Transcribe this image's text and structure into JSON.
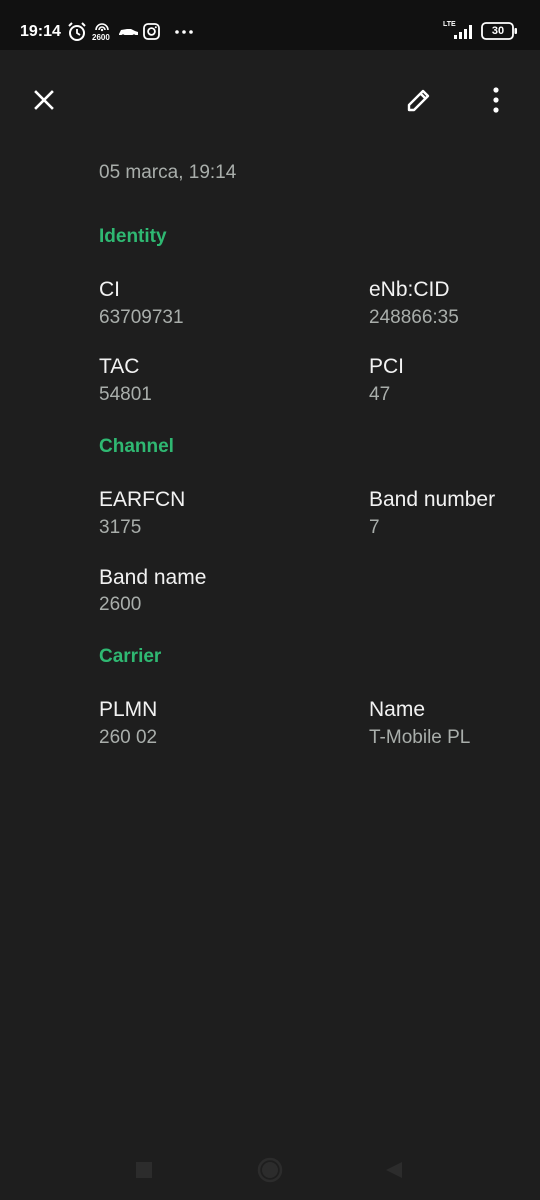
{
  "status_bar": {
    "time": "19:14",
    "hotspot_label": "2600",
    "network_type": "LTE",
    "battery_level": "30",
    "icons": [
      "alarm-icon",
      "hotspot-icon",
      "car-icon",
      "instagram-icon",
      "more-dots-icon",
      "signal-icon",
      "battery-icon"
    ]
  },
  "toolbar": {
    "icons": [
      "close-icon",
      "edit-icon",
      "more-vert-icon"
    ]
  },
  "record": {
    "timestamp": "05 marca, 19:14"
  },
  "sections": {
    "identity": {
      "title": "Identity",
      "ci_label": "CI",
      "ci_value": "63709731",
      "enb_label": "eNb:CID",
      "enb_value": "248866:35",
      "tac_label": "TAC",
      "tac_value": "54801",
      "pci_label": "PCI",
      "pci_value": "47"
    },
    "channel": {
      "title": "Channel",
      "earfcn_label": "EARFCN",
      "earfcn_value": "3175",
      "band_number_label": "Band number",
      "band_number_value": "7",
      "band_name_label": "Band name",
      "band_name_value": "2600"
    },
    "carrier": {
      "title": "Carrier",
      "plmn_label": "PLMN",
      "plmn_value": "260 02",
      "name_label": "Name",
      "name_value": "T-Mobile PL"
    }
  },
  "nav_bar": {
    "icons": [
      "recents-icon",
      "home-icon",
      "back-icon"
    ]
  },
  "colors": {
    "background": "#1e1e1e",
    "status_bar": "#111111",
    "accent": "#2fb872",
    "label_text": "#f2f2f2",
    "value_text": "#a9aeab",
    "nav_icon": "#2a2a2a"
  }
}
